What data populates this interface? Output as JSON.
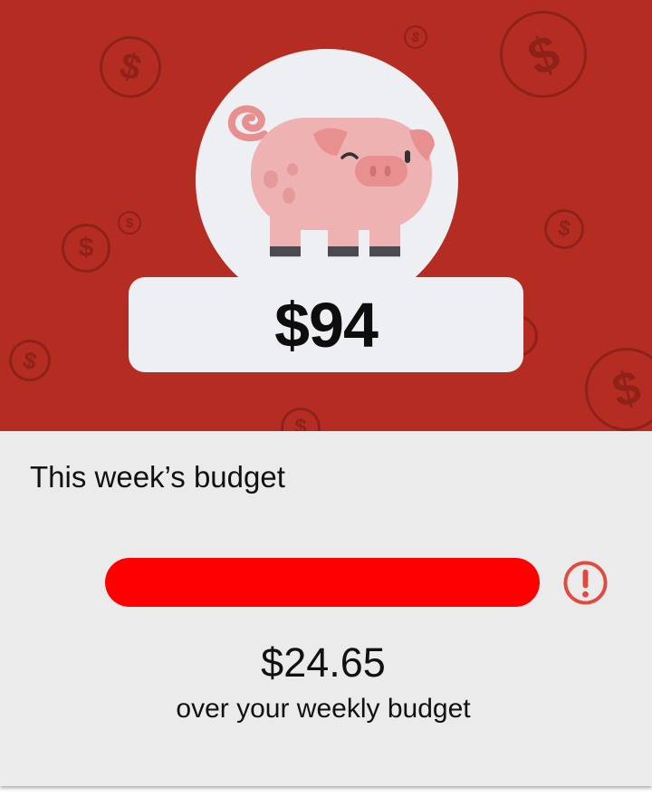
{
  "summary": {
    "amount": "$94"
  },
  "budget": {
    "title": "This week’s budget",
    "progress_fraction": 1.0,
    "bar_color": "#ff0000",
    "over_amount": "$24.65",
    "over_label": "over your weekly budget",
    "alert_icon": "alert-circle-icon"
  },
  "colors": {
    "hero_background": "#b52c22",
    "card_background": "#ecebec",
    "accent_red": "#e04b3f"
  },
  "icons": {
    "mascot": "piggy-bank-icon",
    "background_pattern": "dollar-coin-icon"
  }
}
